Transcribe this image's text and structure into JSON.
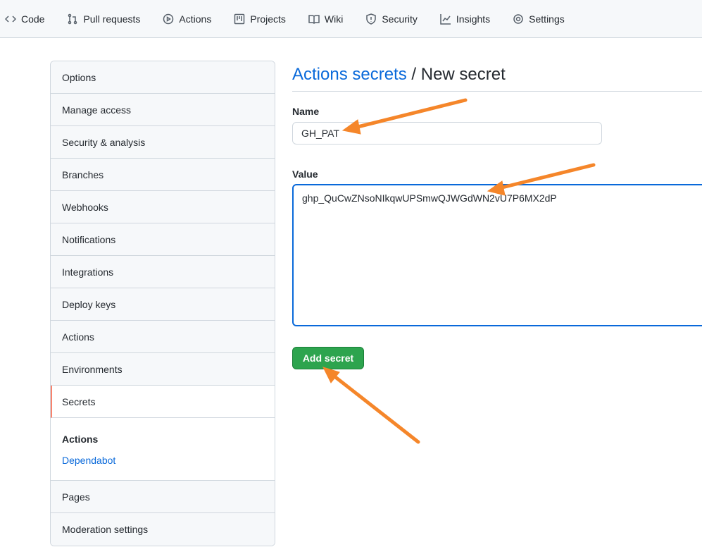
{
  "nav": [
    {
      "label": "Code",
      "icon": "code-icon"
    },
    {
      "label": "Pull requests",
      "icon": "pull-request-icon"
    },
    {
      "label": "Actions",
      "icon": "play-icon"
    },
    {
      "label": "Projects",
      "icon": "project-icon"
    },
    {
      "label": "Wiki",
      "icon": "book-icon"
    },
    {
      "label": "Security",
      "icon": "shield-icon"
    },
    {
      "label": "Insights",
      "icon": "graph-icon"
    },
    {
      "label": "Settings",
      "icon": "gear-icon"
    }
  ],
  "sidebar": {
    "items": [
      "Options",
      "Manage access",
      "Security & analysis",
      "Branches",
      "Webhooks",
      "Notifications",
      "Integrations",
      "Deploy keys",
      "Actions",
      "Environments",
      "Secrets"
    ],
    "selected": "Secrets",
    "sub_heading": "Actions",
    "sub_link": "Dependabot",
    "after": [
      "Pages",
      "Moderation settings"
    ]
  },
  "header": {
    "link": "Actions secrets",
    "rest": " / New secret"
  },
  "form": {
    "name_label": "Name",
    "name_value": "GH_PAT",
    "value_label": "Value",
    "value_value": "ghp_QuCwZNsoNIkqwUPSmwQJWGdWN2vU7P6MX2dP",
    "submit": "Add secret"
  },
  "colors": {
    "accent": "#0969da",
    "button": "#2da44e",
    "selected_border": "#f9826c",
    "annotation_arrow": "#f5862a"
  }
}
